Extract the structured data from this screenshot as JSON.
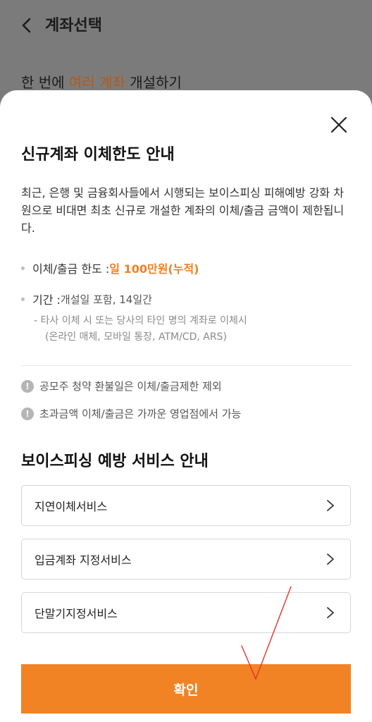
{
  "header": {
    "title": "계좌선택",
    "back_icon": "chevron-left-icon"
  },
  "background": {
    "line_pre": "한 번에 ",
    "line_highlight": "여러 계좌",
    "line_post": " 개설하기",
    "highlight_color": "#b65a16"
  },
  "sheet": {
    "close_icon": "close-icon",
    "title": "신규계좌 이체한도 안내",
    "description": "최근, 은행 및 금융회사들에서 시행되는 보이스피싱 피해예방 강화 차원으로 비대면 최초 신규로 개설한 계좌의 이체/출금 금액이 제한됩니다.",
    "limit": {
      "label": "이체/출금 한도 : ",
      "value": "일 100만원(누적)"
    },
    "period": {
      "label": "기간 : ",
      "value": "개설일 포함, 14일간"
    },
    "sub_note": {
      "line1": "- 타사 이체 시 또는 당사의 타인 명의 계좌로 이체시",
      "line2": "(온라인 매체, 모바일 통장, ATM/CD, ARS)"
    },
    "notices": [
      "공모주 청약 환불일은 이체/출금제한 제외",
      "초과금액 이체/출금은 가까운 영업점에서 가능"
    ],
    "notice_icon": "exclamation-circle-icon",
    "section_title": "보이스피싱 예방 서비스 안내",
    "services": [
      {
        "label": "지연이체서비스"
      },
      {
        "label": "입금계좌 지정서비스"
      },
      {
        "label": "단말기지정서비스"
      }
    ],
    "chevron_icon": "chevron-right-icon",
    "confirm_label": "확인",
    "accent_color": "#f28324"
  },
  "annotation": {
    "check_mark_color": "#e0332a"
  }
}
